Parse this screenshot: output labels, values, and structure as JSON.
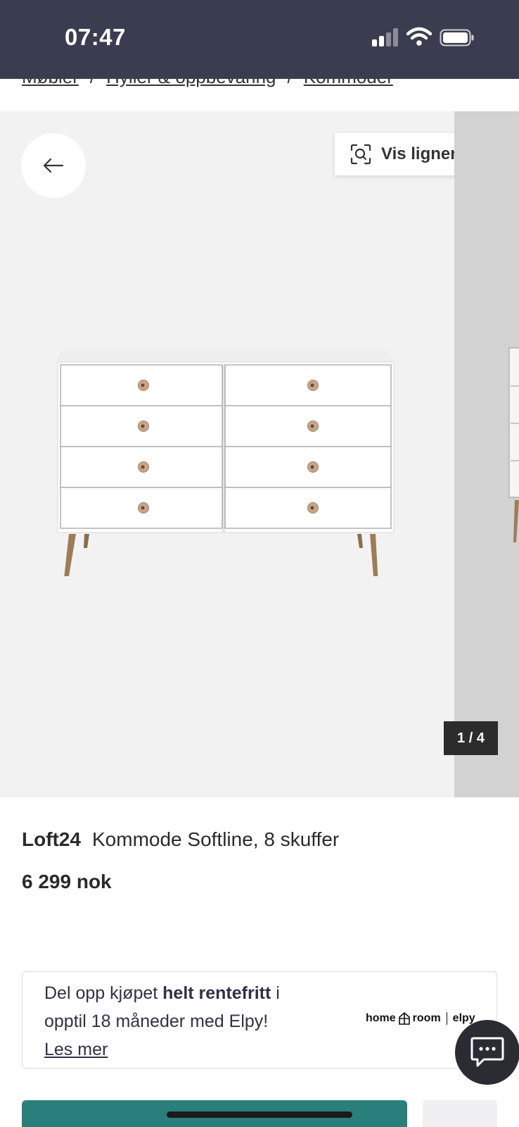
{
  "status_bar": {
    "time": "07:47"
  },
  "breadcrumb": [
    "Møbler",
    "Hyller & oppbevaring",
    "Kommoder"
  ],
  "breadcrumb_separator": "/",
  "gallery": {
    "similar_label": "Vis lignende",
    "counter": "1 / 4",
    "back_icon": "arrow-left-icon",
    "similar_icon": "visual-search-icon"
  },
  "product": {
    "brand": "Loft24",
    "name": "Kommode Softline, 8 skuffer",
    "price": "6 299 nok"
  },
  "financing": {
    "text_before": "Del opp kjøpet ",
    "text_bold": "helt rentefritt",
    "text_after": " i opptil 18 måneder med Elpy!",
    "link": "Les mer",
    "logo_home": "home",
    "logo_room": "room",
    "logo_elpy": "elpy"
  },
  "chat": {
    "icon": "chat-icon"
  },
  "colors": {
    "status_bar": "#3a3d4f",
    "buy_button": "#2a7f7c",
    "image_background": "#f3f2f3"
  }
}
